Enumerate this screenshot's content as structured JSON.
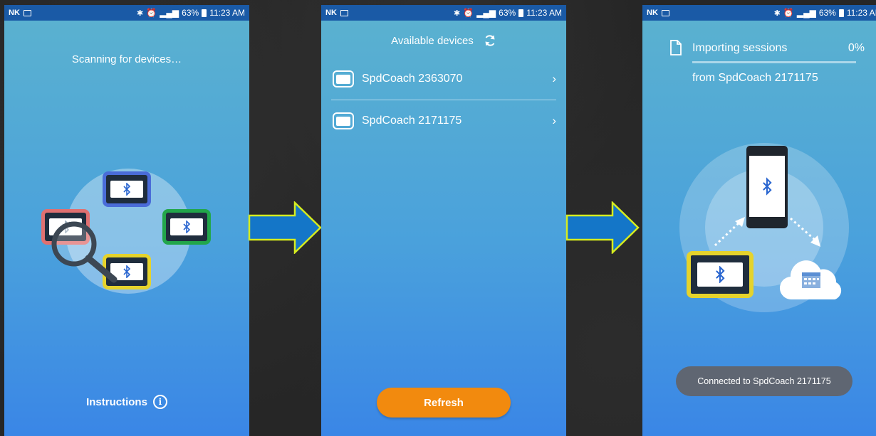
{
  "statusbar": {
    "left_text": "NK",
    "battery": "63%",
    "time": "11:23 AM",
    "time_truncated": "11:23 AI"
  },
  "screen1": {
    "scanning_text": "Scanning for devices…",
    "instructions_label": "Instructions",
    "info_glyph": "i"
  },
  "screen2": {
    "header": "Available devices",
    "devices": [
      {
        "name": "SpdCoach 2363070"
      },
      {
        "name": "SpdCoach 2171175"
      }
    ],
    "refresh_label": "Refresh"
  },
  "screen3": {
    "importing_label": "Importing sessions",
    "import_percent": "0%",
    "import_progress": 0,
    "from_text": "from SpdCoach 2171175",
    "toast": "Connected to SpdCoach 2171175"
  },
  "colors": {
    "accent_orange": "#f28a0e",
    "statusbar": "#1a5aa6",
    "arrow_fill": "#1476c8",
    "arrow_stroke": "#d6ec1f",
    "device_blue": "#4a6cd8",
    "device_green": "#22a64a",
    "device_yellow": "#e5d32c",
    "device_red": "#e07070"
  }
}
